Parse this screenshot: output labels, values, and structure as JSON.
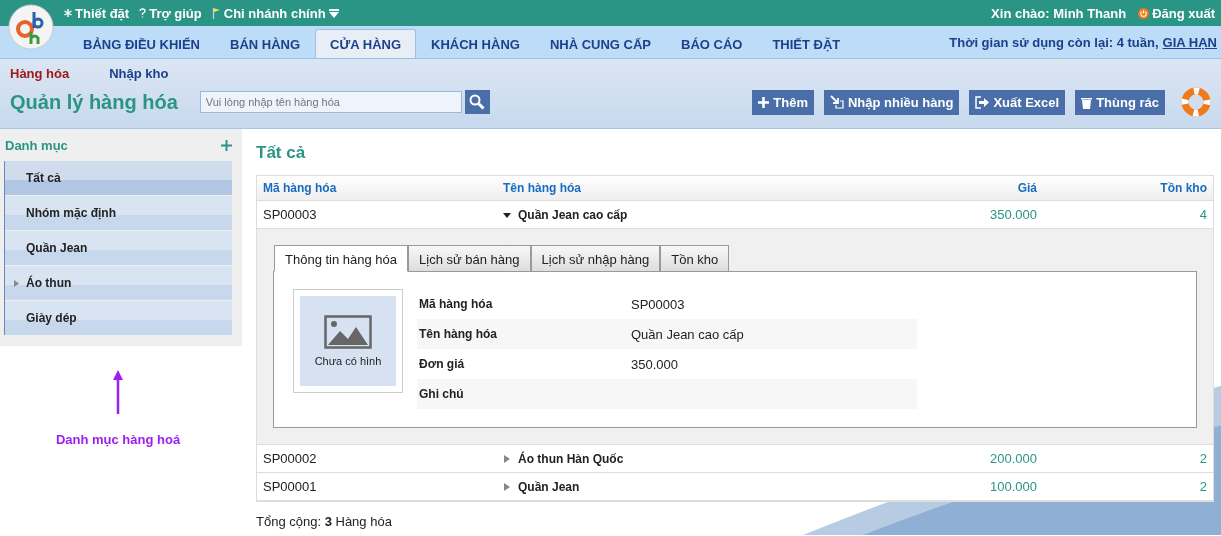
{
  "top_bar": {
    "links": [
      {
        "label": "Thiết đặt",
        "kind": "settings"
      },
      {
        "label": "Trợ giúp",
        "kind": "help"
      },
      {
        "label": "Chi nhánh chính",
        "kind": "branch"
      }
    ],
    "greeting": "Xin chào: Minh Thanh",
    "logout": "Đăng xuất"
  },
  "nav": {
    "tabs": [
      {
        "label": "BẢNG ĐIỀU KHIỂN",
        "selected": false
      },
      {
        "label": "BÁN HÀNG",
        "selected": false
      },
      {
        "label": "CỬA HÀNG",
        "selected": true
      },
      {
        "label": "KHÁCH HÀNG",
        "selected": false
      },
      {
        "label": "NHÀ CUNG CẤP",
        "selected": false
      },
      {
        "label": "BÁO CÁO",
        "selected": false
      },
      {
        "label": "THIẾT ĐẶT",
        "selected": false
      }
    ],
    "usage_text": "Thời gian sử dụng còn lại: 4 tuần,",
    "renew_link": "GIA HẠN"
  },
  "sub_tabs": [
    {
      "label": "Hàng hóa",
      "selected": true
    },
    {
      "label": "Nhập kho",
      "selected": false
    }
  ],
  "page_title": "Quản lý hàng hóa",
  "search": {
    "placeholder": "Vui lòng nhập tên hàng hóa"
  },
  "buttons": [
    {
      "label": "Thêm",
      "kind": "add"
    },
    {
      "label": "Nhập nhiều hàng",
      "kind": "import"
    },
    {
      "label": "Xuất Excel",
      "kind": "export"
    },
    {
      "label": "Thùng rác",
      "kind": "trash"
    }
  ],
  "sidebar": {
    "title": "Danh mục",
    "items": [
      {
        "label": "Tất cả",
        "selected": true,
        "expandable": false
      },
      {
        "label": "Nhóm mặc định",
        "selected": false,
        "expandable": false
      },
      {
        "label": "Quần Jean",
        "selected": false,
        "expandable": false
      },
      {
        "label": "Áo thun",
        "selected": false,
        "expandable": true
      },
      {
        "label": "Giày dép",
        "selected": false,
        "expandable": false
      }
    ]
  },
  "annotation": "Danh mục hàng hoá",
  "content": {
    "heading": "Tất cả",
    "table": {
      "columns": [
        "Mã hàng hóa",
        "Tên hàng hóa",
        "Giá",
        "Tồn kho"
      ],
      "rows": [
        {
          "code": "SP00003",
          "name": "Quần Jean cao cấp",
          "price": "350.000",
          "stock": "4",
          "expanded": true
        },
        {
          "code": "SP00002",
          "name": "Áo thun Hàn Quốc",
          "price": "200.000",
          "stock": "2",
          "expanded": false
        },
        {
          "code": "SP00001",
          "name": "Quần Jean",
          "price": "100.000",
          "stock": "2",
          "expanded": false
        }
      ]
    },
    "detail": {
      "tabs": [
        {
          "label": "Thông tin hàng hóa",
          "selected": true
        },
        {
          "label": "Lịch sử bán hàng",
          "selected": false
        },
        {
          "label": "Lịch sử nhập hàng",
          "selected": false
        },
        {
          "label": "Tồn kho",
          "selected": false
        }
      ],
      "image_label": "Chưa có hình",
      "fields": [
        {
          "label": "Mã hàng hóa",
          "value": "SP00003"
        },
        {
          "label": "Tên hàng hóa",
          "value": "Quần Jean cao cấp"
        },
        {
          "label": "Đơn giá",
          "value": "350.000"
        },
        {
          "label": "Ghi chú"
        }
      ]
    },
    "total": "Tổng cộng: **3** Hàng hóa"
  }
}
